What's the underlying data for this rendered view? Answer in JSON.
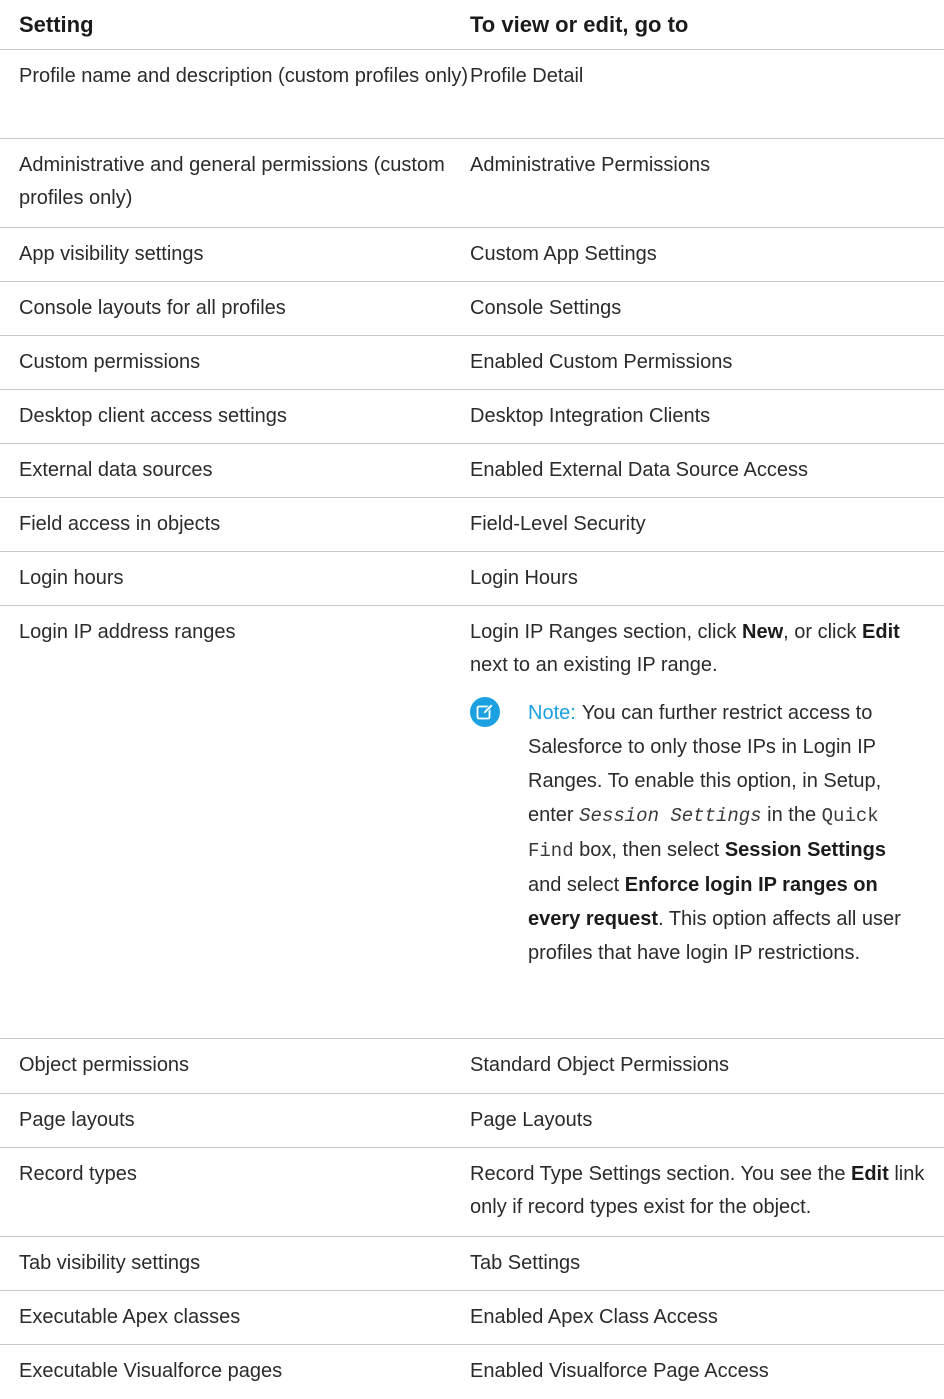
{
  "header": {
    "setting": "Setting",
    "location": "To view or edit, go to"
  },
  "rows": [
    {
      "setting": "Profile name and description (custom profiles only)",
      "location": "Profile Detail"
    },
    {
      "setting": "Administrative and general permissions (custom profiles only)",
      "location": "Administrative Permissions"
    },
    {
      "setting": "App visibility settings",
      "location": "Custom App Settings"
    },
    {
      "setting": "Console layouts for all profiles",
      "location": "Console Settings"
    },
    {
      "setting": "Custom permissions",
      "location": "Enabled Custom Permissions"
    },
    {
      "setting": "Desktop client access settings",
      "location": "Desktop Integration Clients"
    },
    {
      "setting": "External data sources",
      "location": "Enabled External Data Source Access"
    },
    {
      "setting": "Field access in objects",
      "location": "Field-Level Security"
    },
    {
      "setting": "Login hours",
      "location": "Login Hours"
    },
    {
      "setting": "Login IP address ranges",
      "location_parts": [
        "Login IP Ranges section, click ",
        "New",
        ", or click ",
        "Edit",
        " next to an existing IP range."
      ]
    },
    {
      "setting": "Object permissions",
      "location": "Standard Object Permissions"
    },
    {
      "setting": "Page layouts",
      "location": "Page Layouts"
    },
    {
      "setting": "Record types",
      "location_parts": [
        "Record Type Settings section. You see the ",
        "Edit",
        " link only if record types exist for the object."
      ]
    },
    {
      "setting": "Tab visibility settings",
      "location": "Tab Settings"
    },
    {
      "setting": "Executable Apex classes",
      "location": "Enabled Apex Class Access"
    },
    {
      "setting": "Executable Visualforce pages",
      "location": "Enabled Visualforce Page Access"
    }
  ],
  "note": {
    "icon": "edit-note-icon",
    "label": "Note:",
    "t1": "You can further restrict access to Salesforce to only those IPs in Login IP Ranges. To enable this option, in Setup, enter ",
    "code1": "Session Settings",
    "t2": " in the ",
    "code2": "Quick Find",
    "t3": " box, then select ",
    "b1": "Session Settings",
    "t4": " and select ",
    "b2": "Enforce login IP ranges on every request",
    "t5": ". This option affects all user profiles that have login IP restrictions."
  },
  "colors": {
    "accent": "#1ba1e2",
    "divider": "#c9c9c9",
    "text": "#2b2b2b"
  }
}
